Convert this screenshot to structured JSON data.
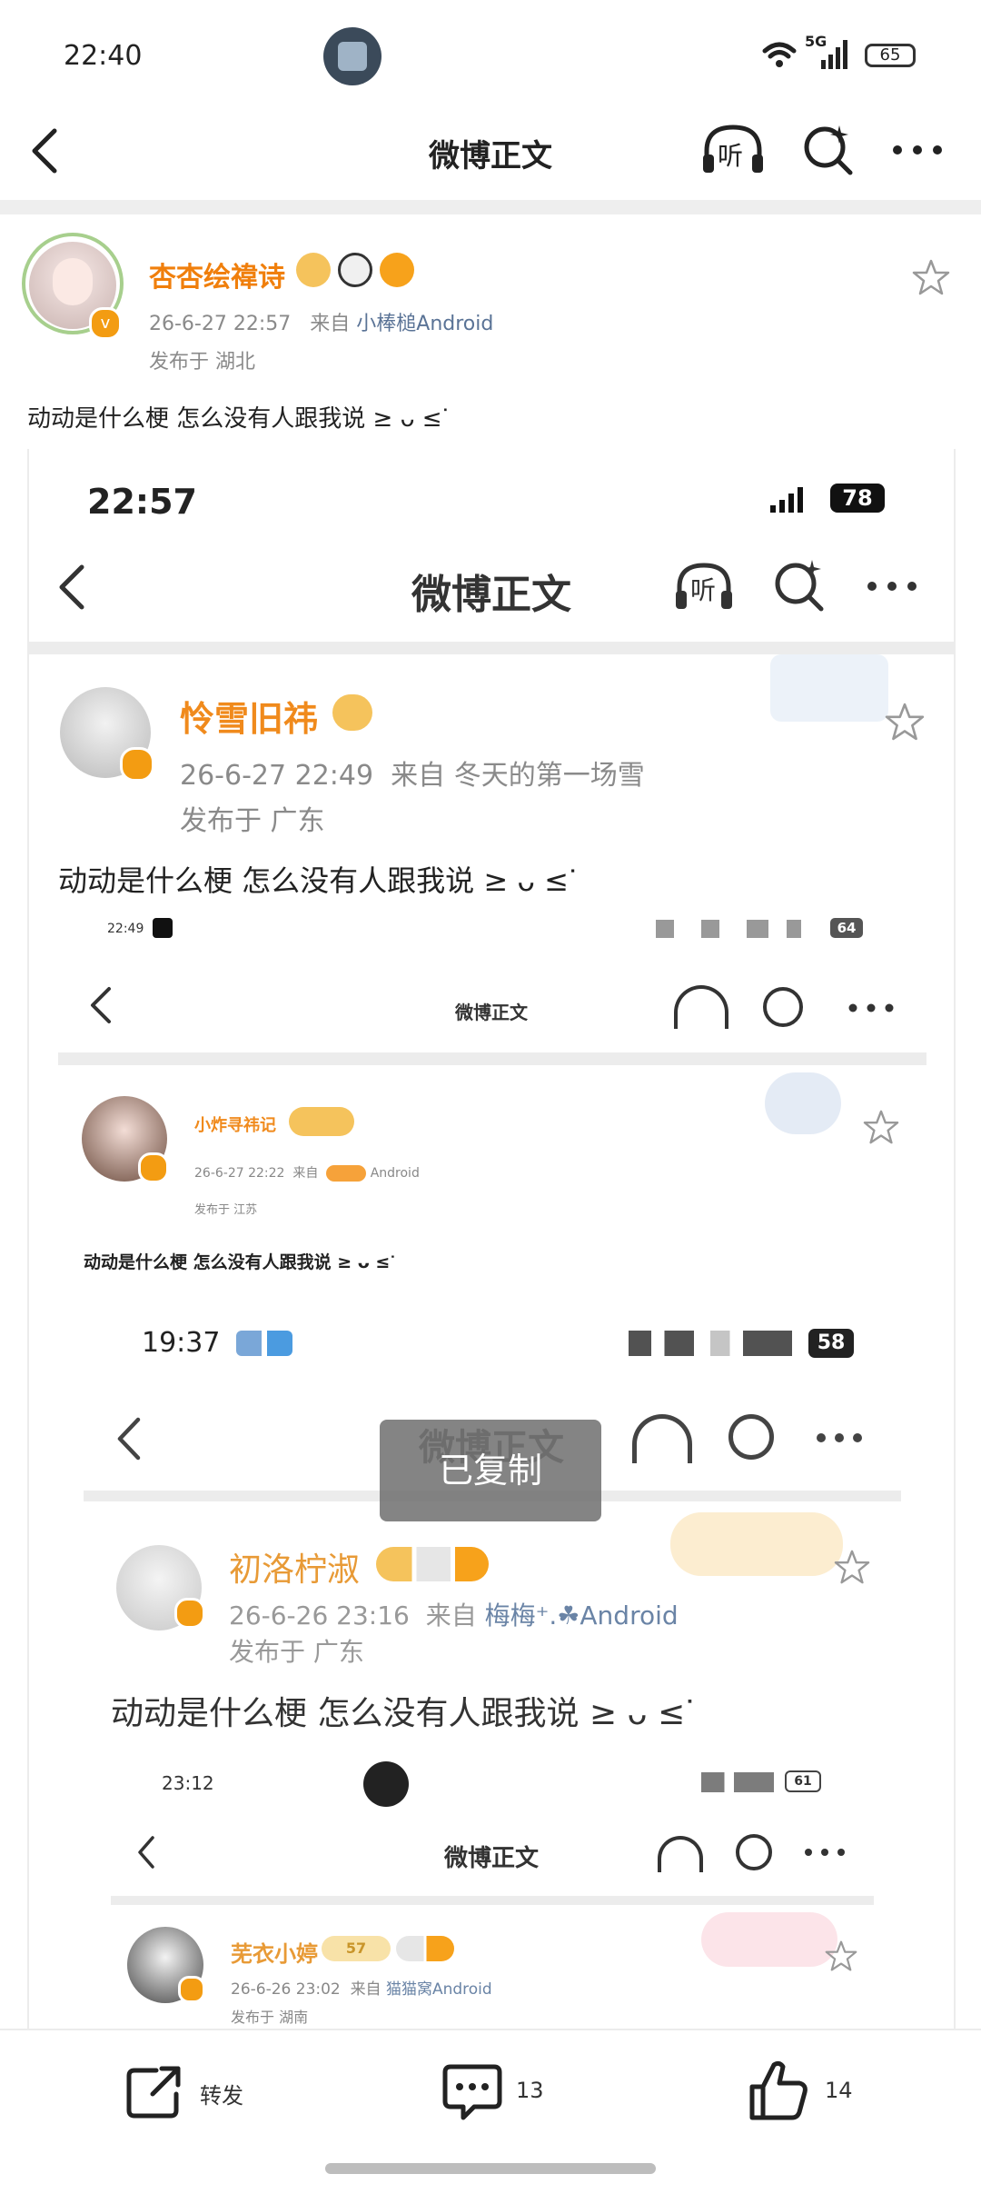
{
  "status_bar": {
    "time": "22:40",
    "network": "5G",
    "battery": "65"
  },
  "header": {
    "title": "微博正文"
  },
  "post": {
    "author": "杏杏绘禕诗",
    "date": "26-6-27 22:57",
    "from_label": "来自",
    "source": "小棒槌Android",
    "location": "发布于 湖北",
    "text": "动动是什么梗 怎么没有人跟我说 ≥ ᴗ ≤ᐝ"
  },
  "embed1": {
    "time": "22:57",
    "battery": "78",
    "title": "微博正文",
    "author": "怜雪旧祎",
    "date": "26-6-27 22:49",
    "from_label": "来自",
    "source": "冬天的第一场雪",
    "location": "发布于 广东",
    "text": "动动是什么梗 怎么没有人跟我说 ≥ ᴗ ≤ᐝ"
  },
  "embed2": {
    "time": "22:49",
    "battery": "64",
    "title": "微博正文",
    "author": "小炸寻祎记",
    "date": "26-6-27 22:22",
    "from_label": "来自",
    "source": "Android",
    "location": "发布于 江苏",
    "text": "动动是什么梗 怎么没有人跟我说 ≥ ᴗ ≤ᐝ"
  },
  "embed3": {
    "time": "19:37",
    "battery": "58",
    "title": "微博正文",
    "author": "初洛柠淑",
    "date": "26-6-26 23:16",
    "from_label": "来自",
    "source": "梅梅⁺.☘Android",
    "location": "发布于 广东",
    "text": "动动是什么梗 怎么没有人跟我说 ≥ ᴗ ≤ᐝ"
  },
  "embed4": {
    "time": "23:12",
    "battery": "61",
    "title": "微博正文",
    "author": "芜衣小婷",
    "level": "57",
    "date": "26-6-26 23:02",
    "from_label": "来自",
    "source": "猫猫窝Android",
    "location": "发布于 湖南"
  },
  "toast": {
    "text": "已复制"
  },
  "listen_label": "听",
  "bottom_bar": {
    "repost_label": "转发",
    "comment_count": "13",
    "like_count": "14"
  }
}
